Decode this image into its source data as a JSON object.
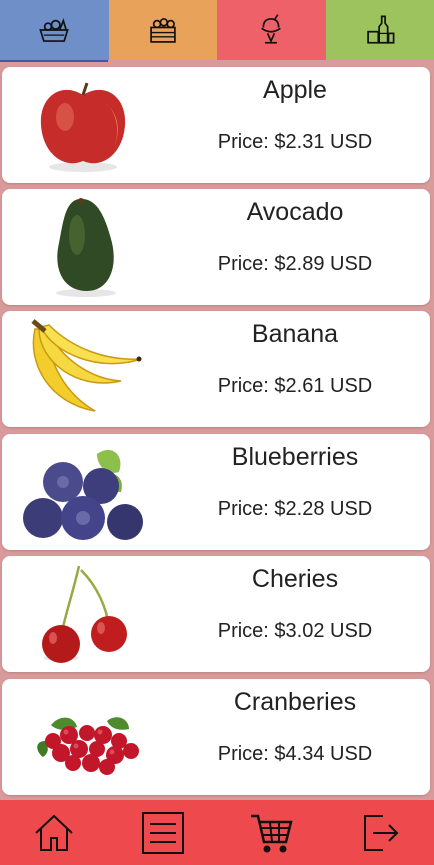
{
  "colors": {
    "tab_fruits": "#6e8fc7",
    "tab_bakery": "#e8a25a",
    "tab_desserts": "#ee6168",
    "tab_drinks": "#9cc35e",
    "background": "#d89a9a",
    "bottom_nav": "#ee4a4e"
  },
  "top_tabs": [
    {
      "icon": "fruit-basket-icon"
    },
    {
      "icon": "crate-icon"
    },
    {
      "icon": "ice-cream-icon"
    },
    {
      "icon": "bottles-icon"
    }
  ],
  "products": [
    {
      "name": "Apple",
      "price": "Price: $2.31 USD",
      "image": "apple-image"
    },
    {
      "name": "Avocado",
      "price": "Price: $2.89 USD",
      "image": "avocado-image"
    },
    {
      "name": "Banana",
      "price": "Price: $2.61 USD",
      "image": "banana-image"
    },
    {
      "name": "Blueberries",
      "price": "Price: $2.28 USD",
      "image": "blueberries-image"
    },
    {
      "name": "Cheries",
      "price": "Price: $3.02 USD",
      "image": "cherries-image"
    },
    {
      "name": "Cranberies",
      "price": "Price: $4.34 USD",
      "image": "cranberries-image"
    }
  ],
  "bottom_nav": [
    {
      "icon": "home-icon"
    },
    {
      "icon": "list-icon"
    },
    {
      "icon": "cart-icon"
    },
    {
      "icon": "logout-icon"
    }
  ]
}
